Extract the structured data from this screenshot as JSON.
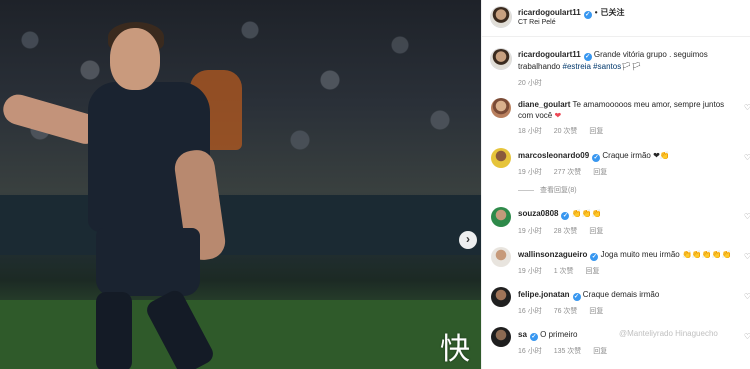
{
  "post": {
    "image_alt": "",
    "next_icon": "chevron-right"
  },
  "header": {
    "username": "ricardogoulart11",
    "separator": "•",
    "follow_label": "已关注",
    "location": "CT Rei Pelé"
  },
  "caption": {
    "username": "ricardogoulart11",
    "text": "Grande vitória grupo . seguimos trabalhando",
    "hashtags": "#estreia #santos",
    "tail": "🏳🏳",
    "time": "20 小时"
  },
  "comments": [
    {
      "username": "diane_goulart",
      "text": "Te amamooooos meu amor, sempre juntos com você",
      "emoji": "❤",
      "time": "18 小时",
      "likes": "20 次赞",
      "reply": "回复"
    },
    {
      "username": "marcosleonardo09",
      "text": "Craque irmão",
      "emoji": "❤👏",
      "time": "19 小时",
      "likes": "277 次赞",
      "reply": "回复",
      "view_replies": "查看回复(8)"
    },
    {
      "username": "souza0808",
      "text": "",
      "emoji": "👏👏👏",
      "time": "19 小时",
      "likes": "28 次赞",
      "reply": "回复"
    },
    {
      "username": "wallinsonzagueiro",
      "text": "Joga muito meu irmão",
      "emoji": "👏👏👏👏👏",
      "time": "19 小时",
      "likes": "1 次赞",
      "reply": "回复"
    },
    {
      "username": "felipe.jonatan",
      "text": "Craque demais irmão",
      "emoji": "",
      "time": "16 小时",
      "likes": "76 次赞",
      "reply": "回复"
    },
    {
      "username": "sa",
      "text": "O primeiro",
      "emoji": "",
      "time": "16 小时",
      "likes": "135 次赞",
      "reply": "回复"
    }
  ],
  "watermark": "快",
  "overlay_text": "@Manteliyrado Hinaguecho",
  "colors": {
    "verified": "#3897f0",
    "hashtag": "#00376b",
    "meta": "#8e8e8e",
    "heart": "#ed4956"
  }
}
